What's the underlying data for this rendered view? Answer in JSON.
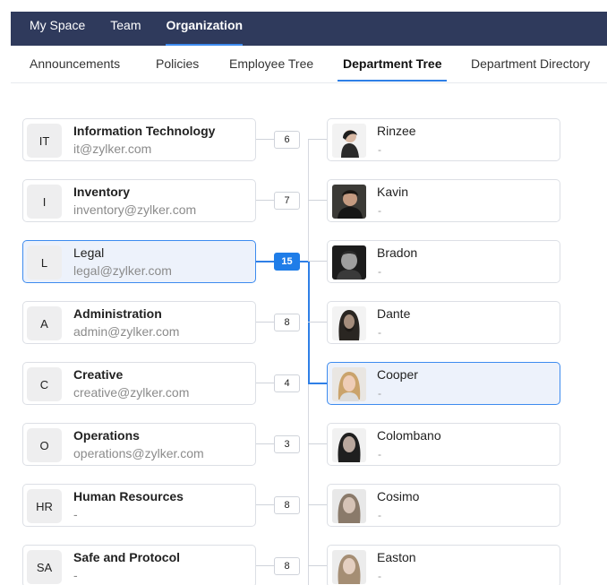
{
  "topnav": [
    {
      "label": "My Space"
    },
    {
      "label": "Team"
    },
    {
      "label": "Organization",
      "active": true
    }
  ],
  "subnav": [
    {
      "label": "Announcements"
    },
    {
      "label": "Policies"
    },
    {
      "label": "Employee Tree"
    },
    {
      "label": "Department Tree",
      "active": true
    },
    {
      "label": "Department Directory"
    }
  ],
  "departments": [
    {
      "code": "IT",
      "name": "Information Technology",
      "sub": "it@zylker.com",
      "count": "6"
    },
    {
      "code": "I",
      "name": "Inventory",
      "sub": "inventory@zylker.com",
      "count": "7"
    },
    {
      "code": "L",
      "name": "Legal",
      "sub": "legal@zylker.com",
      "count": "15",
      "selected": true
    },
    {
      "code": "A",
      "name": "Administration",
      "sub": "admin@zylker.com",
      "count": "8"
    },
    {
      "code": "C",
      "name": "Creative",
      "sub": "creative@zylker.com",
      "count": "4"
    },
    {
      "code": "O",
      "name": "Operations",
      "sub": "operations@zylker.com",
      "count": "3"
    },
    {
      "code": "HR",
      "name": "Human Resources",
      "sub": "-",
      "count": "8"
    },
    {
      "code": "SA",
      "name": "Safe and Protocol",
      "sub": "-",
      "count": "8"
    }
  ],
  "members": [
    {
      "name": "Rinzee",
      "sub": "-"
    },
    {
      "name": "Kavin",
      "sub": "-"
    },
    {
      "name": "Bradon",
      "sub": "-"
    },
    {
      "name": "Dante",
      "sub": "-"
    },
    {
      "name": "Cooper",
      "sub": "-",
      "selected": true
    },
    {
      "name": "Colombano",
      "sub": "-"
    },
    {
      "name": "Cosimo",
      "sub": "-"
    },
    {
      "name": "Easton",
      "sub": "-"
    }
  ],
  "colors": {
    "topbar": "#2f3a5c",
    "accent": "#2f7fe6",
    "selected_bg": "#edf2fb"
  }
}
